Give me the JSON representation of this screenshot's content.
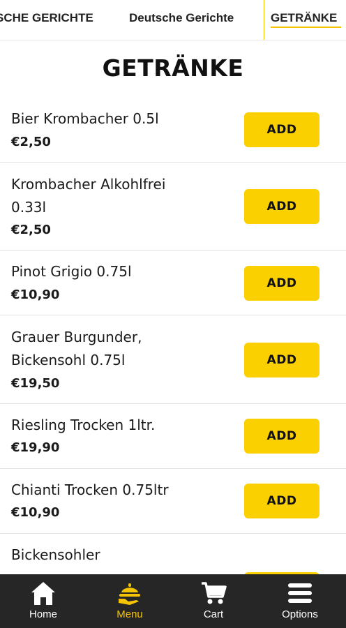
{
  "tabs": [
    {
      "label": "SCHE GERICHTE",
      "active": false
    },
    {
      "label": "Deutsche Gerichte",
      "active": false
    },
    {
      "label": "GETRÄNKE",
      "active": true
    }
  ],
  "section_title": "GETRÄNKE",
  "items": [
    {
      "name_line1": "Bier Krombacher 0.5l",
      "name_line2": "",
      "price": "€2,50",
      "add_label": "ADD"
    },
    {
      "name_line1": "Krombacher Alkohlfrei",
      "name_line2": "0.33l",
      "price": "€2,50",
      "add_label": "ADD"
    },
    {
      "name_line1": "Pinot Grigio 0.75l",
      "name_line2": "",
      "price": "€10,90",
      "add_label": "ADD"
    },
    {
      "name_line1": "Grauer Burgunder,",
      "name_line2": "Bickensohl 0.75l",
      "price": "€19,50",
      "add_label": "ADD"
    },
    {
      "name_line1": "Riesling Trocken 1ltr.",
      "name_line2": "",
      "price": "€19,90",
      "add_label": "ADD"
    },
    {
      "name_line1": "Chianti Trocken 0.75ltr",
      "name_line2": "",
      "price": "€10,90",
      "add_label": "ADD"
    },
    {
      "name_line1": "Bickensohler",
      "name_line2": "",
      "price": "",
      "add_label": ""
    }
  ],
  "bottom_nav": [
    {
      "label": "Home",
      "icon": "home-icon",
      "active": false
    },
    {
      "label": "Menu",
      "icon": "menu-dish-icon",
      "active": true
    },
    {
      "label": "Cart",
      "icon": "cart-icon",
      "active": false
    },
    {
      "label": "Options",
      "icon": "options-icon",
      "active": false
    }
  ],
  "colors": {
    "accent": "#fbd000",
    "bar": "#262626"
  }
}
